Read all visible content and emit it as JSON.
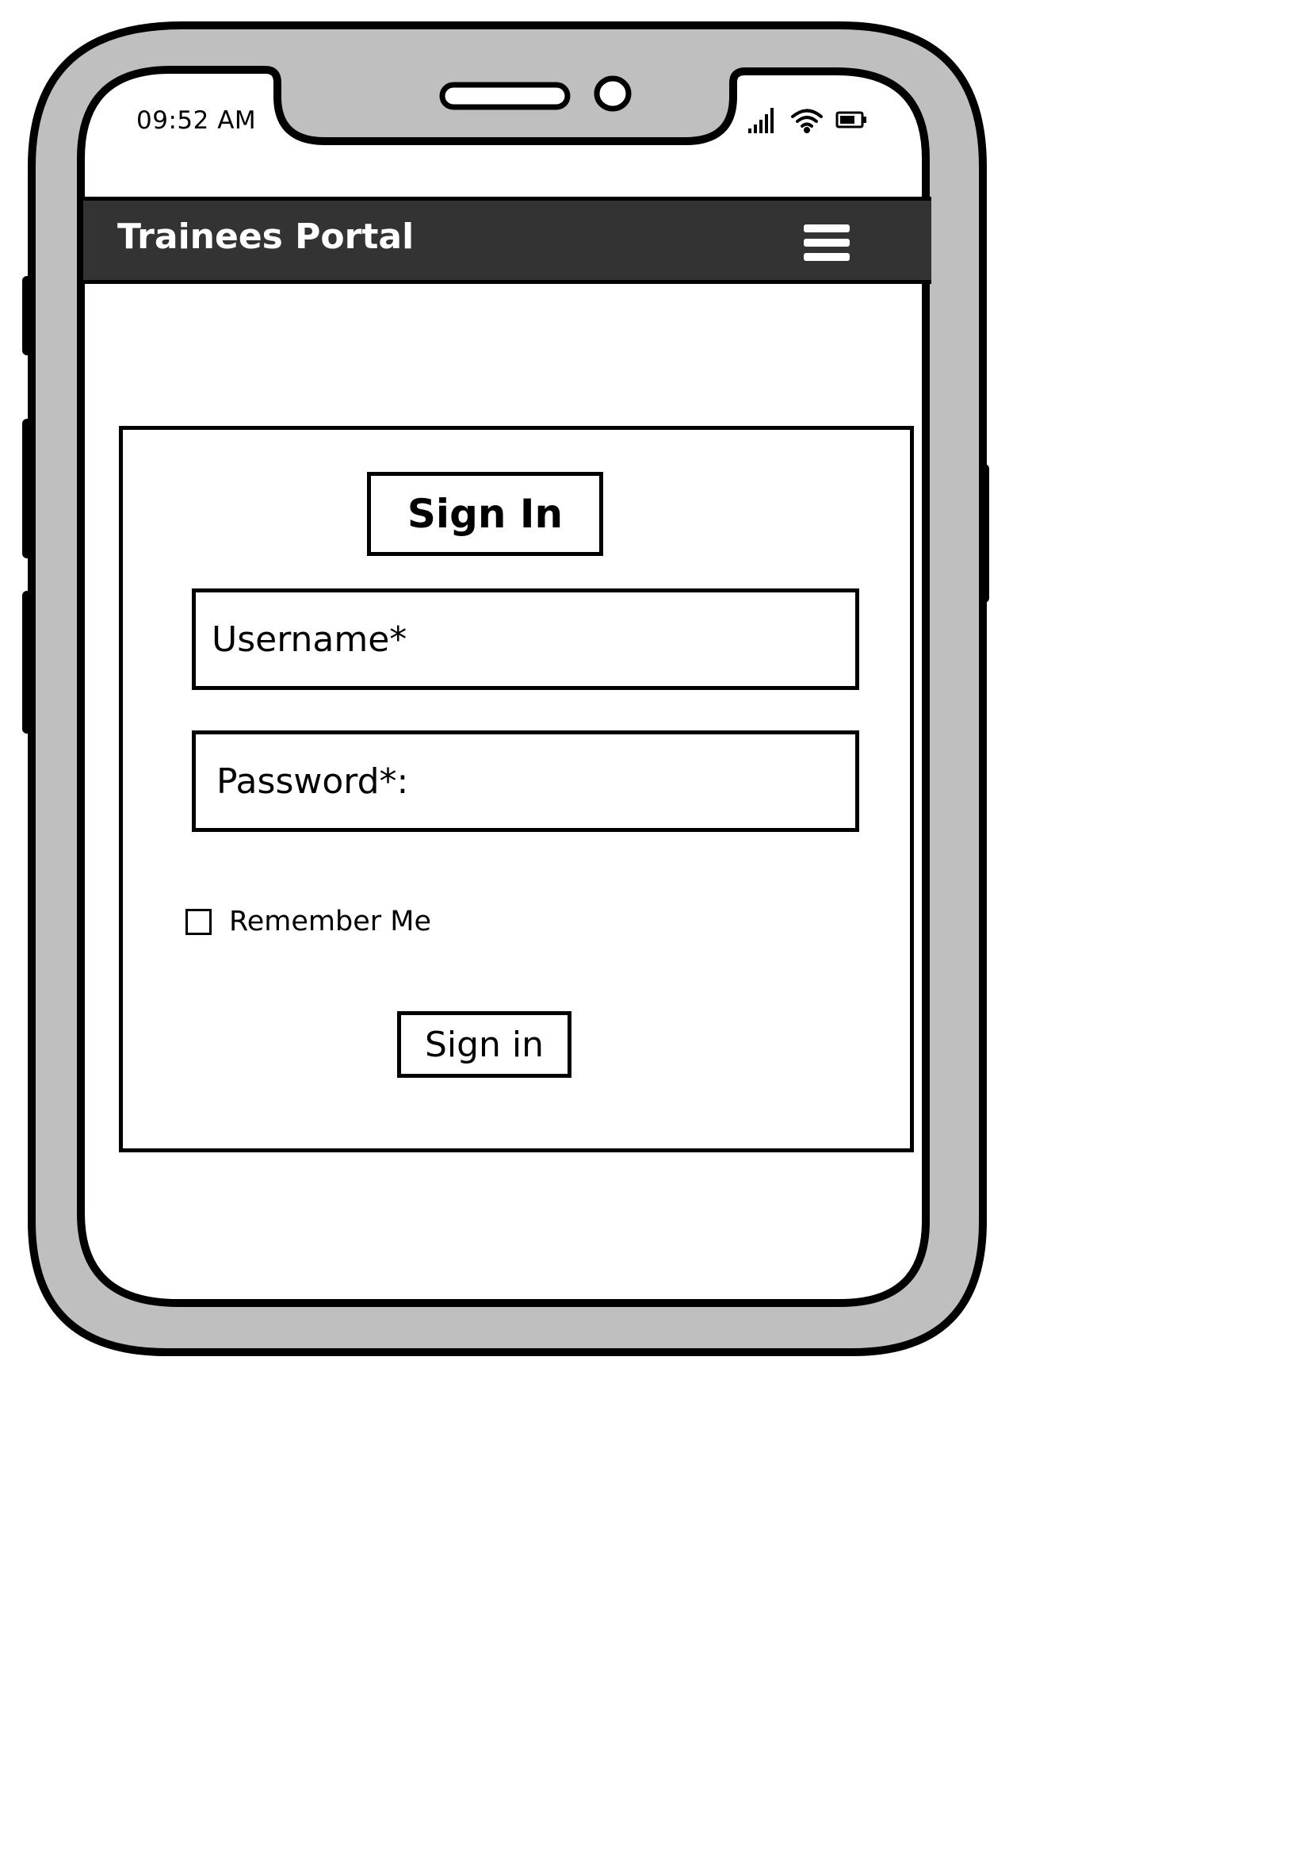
{
  "status_bar": {
    "time": "09:52 AM",
    "icons": [
      "signal-icon",
      "wifi-icon",
      "battery-icon"
    ]
  },
  "app_bar": {
    "title": "Trainees Portal",
    "menu_icon": "hamburger-menu-icon",
    "background_color": "#333333",
    "title_color": "#ffffff"
  },
  "sign_in_card": {
    "title": "Sign In",
    "username": {
      "placeholder": "Username*",
      "value": ""
    },
    "password": {
      "placeholder": "Password*:",
      "value": ""
    },
    "remember_me": {
      "label": "Remember Me",
      "checked": false
    },
    "submit_label": "Sign in"
  },
  "device": {
    "frame_color": "#c0bfc0",
    "outline_color": "#000000"
  }
}
